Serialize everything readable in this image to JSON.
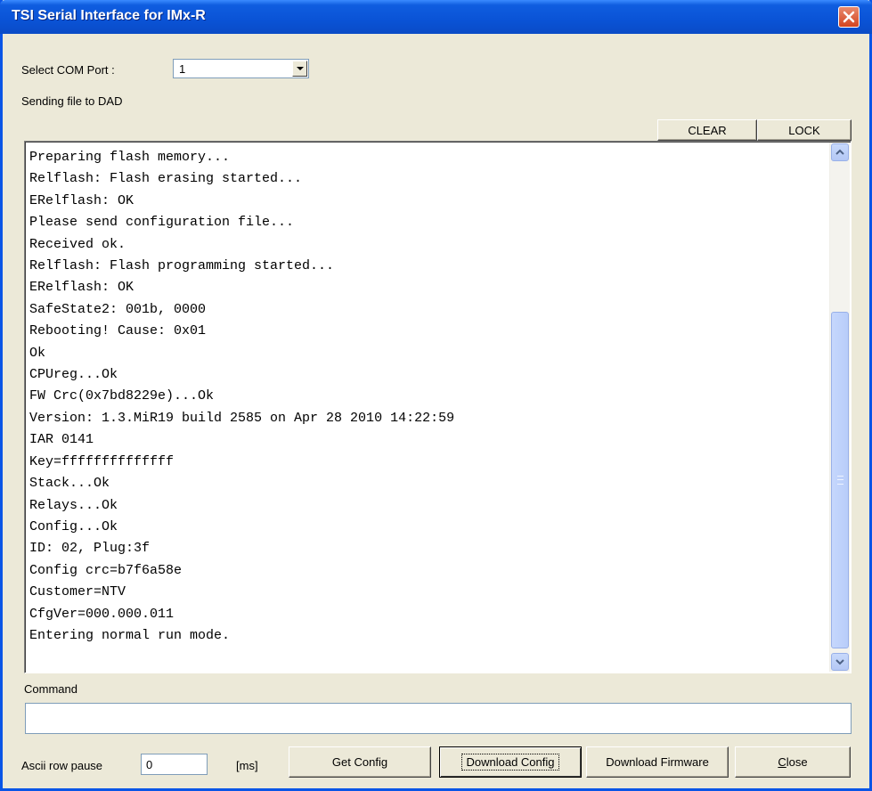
{
  "window": {
    "title": "TSI Serial Interface for IMx-R"
  },
  "com_port": {
    "label": "Select COM Port :",
    "value": "1"
  },
  "status_text": "Sending file to DAD",
  "toolbar": {
    "clear_label": "CLEAR",
    "lock_label": "LOCK"
  },
  "terminal": {
    "lines": [
      "Preparing flash memory...",
      "Relflash: Flash erasing started...",
      "ERelflash: OK",
      "Please send configuration file...",
      "Received ok.",
      "Relflash: Flash programming started...",
      "ERelflash: OK",
      "SafeState2: 001b, 0000",
      "Rebooting! Cause: 0x01",
      "Ok",
      "CPUreg...Ok",
      "FW Crc(0x7bd8229e)...Ok",
      "Version: 1.3.MiR19 build 2585 on Apr 28 2010 14:22:59",
      "IAR 0141",
      "Key=ffffffffffffff",
      "Stack...Ok",
      "Relays...Ok",
      "Config...Ok",
      "ID: 02, Plug:3f",
      "Config crc=b7f6a58e",
      "Customer=NTV",
      "CfgVer=000.000.011",
      "Entering normal run mode."
    ]
  },
  "command": {
    "label": "Command",
    "value": ""
  },
  "ascii_pause": {
    "label": "Ascii row pause",
    "value": "0",
    "unit": "[ms]"
  },
  "buttons": {
    "get_config": "Get Config",
    "download_config": "Download Config",
    "download_firmware": "Download Firmware",
    "close": "Close"
  },
  "icons": {
    "close": "close-x-icon",
    "dropdown": "chevron-down-icon",
    "scroll_up": "arrow-up-icon",
    "scroll_down": "arrow-down-icon"
  },
  "colors": {
    "titlebar": "#0a53d6",
    "close_button": "#d3441f",
    "face": "#ece9d8",
    "scroll_thumb": "#c6d7fc"
  }
}
